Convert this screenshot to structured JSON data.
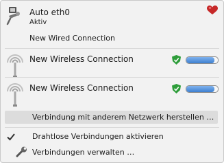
{
  "wired": {
    "title": "Auto eth0",
    "status": "Aktiv",
    "connection_name": "New Wired Connection",
    "icon": "ethernet-icon"
  },
  "wireless": [
    {
      "label": "New Wireless Connection",
      "icon": "wifi-icon",
      "secured": true,
      "signal_percent": 90
    },
    {
      "label": "New Wireless Connection",
      "icon": "wifi-icon",
      "secured": true,
      "signal_percent": 90
    }
  ],
  "actions": {
    "connect_other": "Verbindung mit anderem Netzwerk herstellen …",
    "enable_wireless": "Drahtlose Verbindungen aktivieren",
    "enable_wireless_checked": true,
    "manage": "Verbindungen verwalten …"
  },
  "colors": {
    "heart": "#c62828",
    "shield": "#2e9d3a",
    "signal": "#3d7fd0",
    "highlight": "#dcdcdc"
  }
}
